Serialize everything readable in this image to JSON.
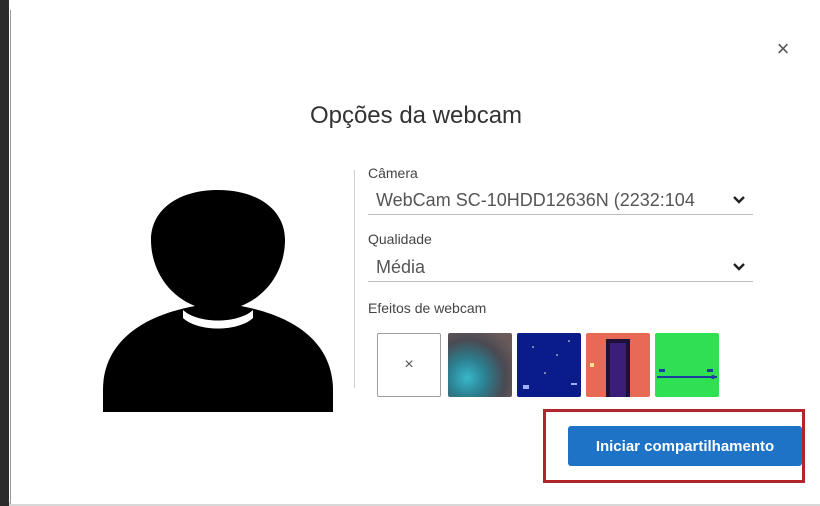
{
  "dialog": {
    "title": "Opções da webcam",
    "close_label": "×"
  },
  "camera": {
    "label": "Câmera",
    "value": "WebCam SC-10HDD12636N (2232:104"
  },
  "quality": {
    "label": "Qualidade",
    "value": "Média"
  },
  "effects": {
    "label": "Efeitos de webcam",
    "none_label": "×",
    "items": [
      "none",
      "blur",
      "space",
      "room",
      "green-screen"
    ]
  },
  "actions": {
    "start_label": "Iniciar compartilhamento"
  },
  "colors": {
    "primary": "#1f73c7",
    "highlight": "#b0262a"
  },
  "icons": [
    "close-icon",
    "chevron-down-icon",
    "avatar-silhouette"
  ]
}
